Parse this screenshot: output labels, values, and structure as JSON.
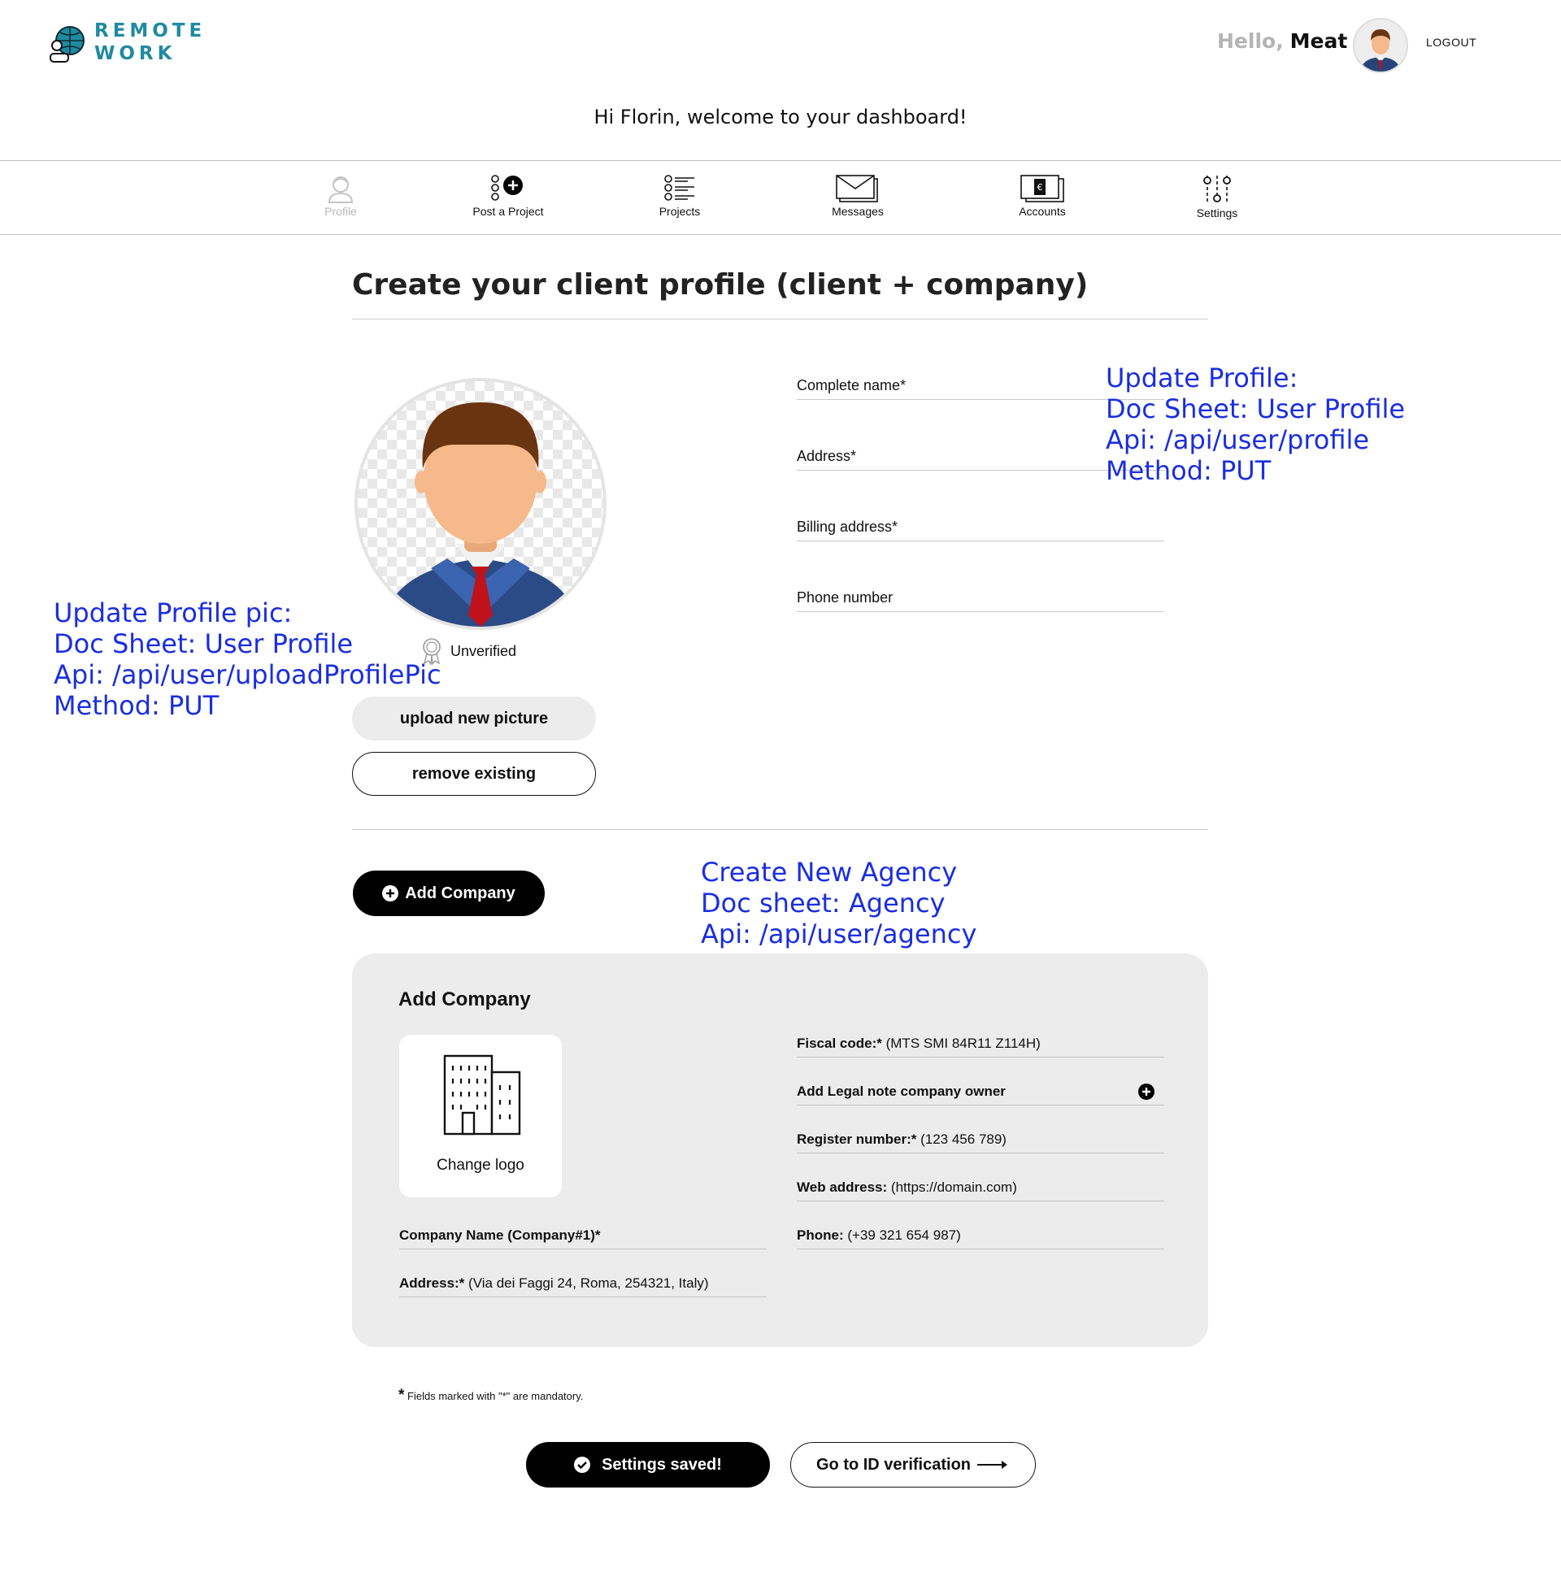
{
  "header": {
    "logo_line1": "REMOTE",
    "logo_line2": "WORK",
    "hello_prefix": "Hello,",
    "hello_name": "Meat",
    "logout_label": "LOGOUT",
    "welcome_text": "Hi Florin, welcome to your dashboard!"
  },
  "nav": {
    "items": [
      {
        "label": "Profile",
        "icon": "profile-icon",
        "active": false
      },
      {
        "label": "Post a Project",
        "icon": "post-project-icon"
      },
      {
        "label": "Projects",
        "icon": "projects-list-icon"
      },
      {
        "label": "Messages",
        "icon": "messages-icon"
      },
      {
        "label": "Accounts",
        "icon": "accounts-icon"
      },
      {
        "label": "Settings",
        "icon": "settings-icon"
      }
    ]
  },
  "main": {
    "title": "Create your client profile (client + company)",
    "status": "Unverified",
    "upload_label": "upload new picture",
    "remove_label": "remove existing",
    "fields": {
      "complete_name": "Complete name*",
      "address": "Address*",
      "billing_address": "Billing address*",
      "phone_number": "Phone number"
    },
    "add_company_label": "Add Company"
  },
  "annotations": {
    "profile": "Update Profile:\nDoc Sheet: User Profile\nApi: /api/user/profile\nMethod: PUT",
    "profile_pic": "Update Profile pic:\nDoc Sheet: User Profile\nApi: /api/user/uploadProfilePic\nMethod: PUT",
    "agency": "Create New Agency\nDoc sheet: Agency\nApi: /api/user/agency\nMethod: POST"
  },
  "company_panel": {
    "title": "Add Company",
    "change_logo": "Change logo",
    "company_name_label": "Company Name (Company#1)*",
    "address_label": "Address:*",
    "address_value": "(Via dei Faggi 24, Roma, 254321, Italy)",
    "fiscal_label": "Fiscal code:*",
    "fiscal_value": "(MTS SMI 84R11 Z114H)",
    "legal_note_label": "Add Legal note company owner",
    "register_label": "Register number:*",
    "register_value": "(123 456 789)",
    "web_label": "Web address:",
    "web_value": "(https://domain.com)",
    "phone_label": "Phone:",
    "phone_value": "(+39 321 654 987)"
  },
  "footer": {
    "footnote_star": "*",
    "footnote_text": "Fields marked with \"*\" are mandatory.",
    "saved_label": "Settings saved!",
    "id_verification_label": "Go to ID verification"
  },
  "colors": {
    "brand": "#1f8aa0",
    "annotation": "#1a2ee0",
    "panel_bg": "#ececec",
    "primary_button": "#000000"
  }
}
